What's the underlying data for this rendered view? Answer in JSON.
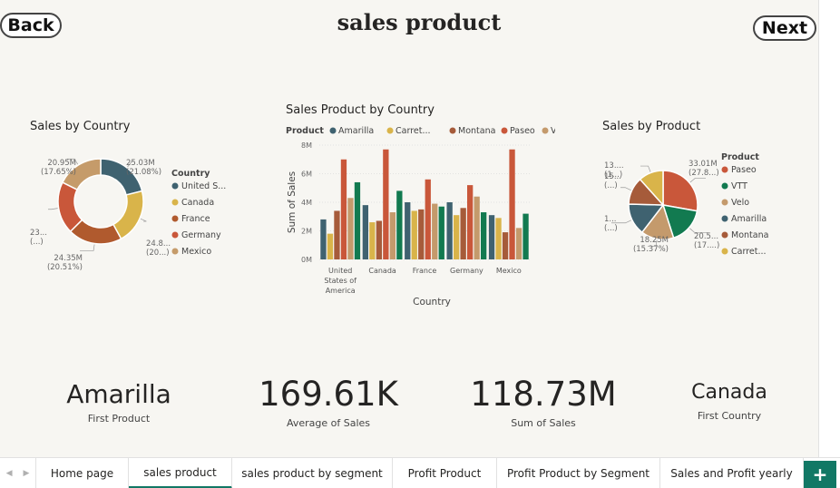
{
  "page": {
    "title": "sales product",
    "back_label": "Back",
    "next_label": "Next"
  },
  "colors": {
    "united_states": "#3f6270",
    "canada": "#d9b44a",
    "france": "#b05a2e",
    "germany": "#c9573a",
    "mexico": "#c59b6a",
    "paseo": "#c9573a",
    "vtt": "#127a50",
    "velo": "#c49a6c",
    "amarilla": "#3f6270",
    "montana": "#a65b3a",
    "carretera": "#d9b44a",
    "accent": "#117865"
  },
  "chart_data": [
    {
      "type": "pie",
      "variant": "donut",
      "title": "Sales by Country",
      "legend_title": "Country",
      "legend_position": "right",
      "slices": [
        {
          "name": "United S...",
          "value": 25.03,
          "label": "25.03M",
          "pct_label": "(21.08%)",
          "color": "#3f6270"
        },
        {
          "name": "Canada",
          "value": 24.89,
          "label": "24.8...",
          "pct_label": "(20...)",
          "color": "#d9b44a"
        },
        {
          "name": "France",
          "value": 24.35,
          "label": "24.35M",
          "pct_label": "(20.51%)",
          "color": "#b05a2e"
        },
        {
          "name": "Germany",
          "value": 23.51,
          "label": "23...",
          "pct_label": "(...)",
          "color": "#c9573a"
        },
        {
          "name": "Mexico",
          "value": 20.95,
          "label": "20.95M",
          "pct_label": "(17.65%)",
          "color": "#c59b6a"
        }
      ]
    },
    {
      "type": "bar",
      "title": "Sales Product by Country",
      "legend_title": "Product",
      "legend_position": "top",
      "xlabel": "Country",
      "ylabel": "Sum of Sales",
      "ylim": [
        0,
        8
      ],
      "yticks": [
        "0M",
        "2M",
        "4M",
        "6M",
        "8M"
      ],
      "categories": [
        "United States of America",
        "Canada",
        "France",
        "Germany",
        "Mexico"
      ],
      "category_label_lines": [
        [
          "United",
          "States of",
          "America"
        ],
        [
          "Canada"
        ],
        [
          "France"
        ],
        [
          "Germany"
        ],
        [
          "Mexico"
        ]
      ],
      "series": [
        {
          "name": "Amarilla",
          "legend_label": "Amarilla",
          "color": "#3f6270",
          "values": [
            2.8,
            3.8,
            4.0,
            4.0,
            3.1
          ]
        },
        {
          "name": "Carretera",
          "legend_label": "Carret...",
          "color": "#d9b44a",
          "values": [
            1.8,
            2.6,
            3.4,
            3.1,
            2.9
          ]
        },
        {
          "name": "Montana",
          "legend_label": "Montana",
          "color": "#a65b3a",
          "values": [
            3.4,
            2.7,
            3.5,
            3.6,
            1.9
          ]
        },
        {
          "name": "Paseo",
          "legend_label": "Paseo",
          "color": "#c9573a",
          "values": [
            7.0,
            7.7,
            5.6,
            5.2,
            7.7
          ]
        },
        {
          "name": "Velo",
          "legend_label": "Velo",
          "color": "#c49a6c",
          "values": [
            4.3,
            3.3,
            3.9,
            4.4,
            2.2
          ]
        },
        {
          "name": "VTT",
          "legend_label": "",
          "color": "#127a50",
          "values": [
            5.4,
            4.8,
            3.7,
            3.3,
            3.2
          ]
        }
      ]
    },
    {
      "type": "pie",
      "title": "Sales by Product",
      "legend_title": "Product",
      "legend_position": "right",
      "slices": [
        {
          "name": "Paseo",
          "value": 33.01,
          "label": "33.01M",
          "pct_label": "(27.8...)",
          "color": "#c9573a"
        },
        {
          "name": "VTT",
          "value": 20.51,
          "label": "20.5...",
          "pct_label": "(17....)",
          "color": "#127a50"
        },
        {
          "name": "Velo",
          "value": 18.25,
          "label": "18.25M",
          "pct_label": "(15.37%)",
          "color": "#c49a6c"
        },
        {
          "name": "Amarilla",
          "value": 17.75,
          "label": "1...",
          "pct_label": "(...)",
          "color": "#3f6270"
        },
        {
          "name": "Montana",
          "value": 15.39,
          "label": "15...",
          "pct_label": "(...)",
          "color": "#a65b3a"
        },
        {
          "name": "Carret...",
          "value": 13.82,
          "label": "13....",
          "pct_label": "(1...)",
          "color": "#d9b44a"
        }
      ]
    }
  ],
  "kpis": [
    {
      "value": "Amarilla",
      "label": "First Product"
    },
    {
      "value": "169.61K",
      "label": "Average of  Sales"
    },
    {
      "value": "118.73M",
      "label": "Sum of  Sales"
    },
    {
      "value": "Canada",
      "label": "First Country"
    }
  ],
  "tabs": [
    {
      "label": "Home page",
      "active": false
    },
    {
      "label": "sales product",
      "active": true
    },
    {
      "label": "sales product by segment",
      "active": false
    },
    {
      "label": "Profit Product",
      "active": false
    },
    {
      "label": "Profit Product by Segment",
      "active": false
    },
    {
      "label": "Sales and Profit yearly",
      "active": false
    }
  ],
  "tab_icons": {
    "prev": "chevron-left-icon",
    "next": "chevron-right-icon",
    "add": "plus-icon",
    "legend_more": "caret-right-icon"
  }
}
